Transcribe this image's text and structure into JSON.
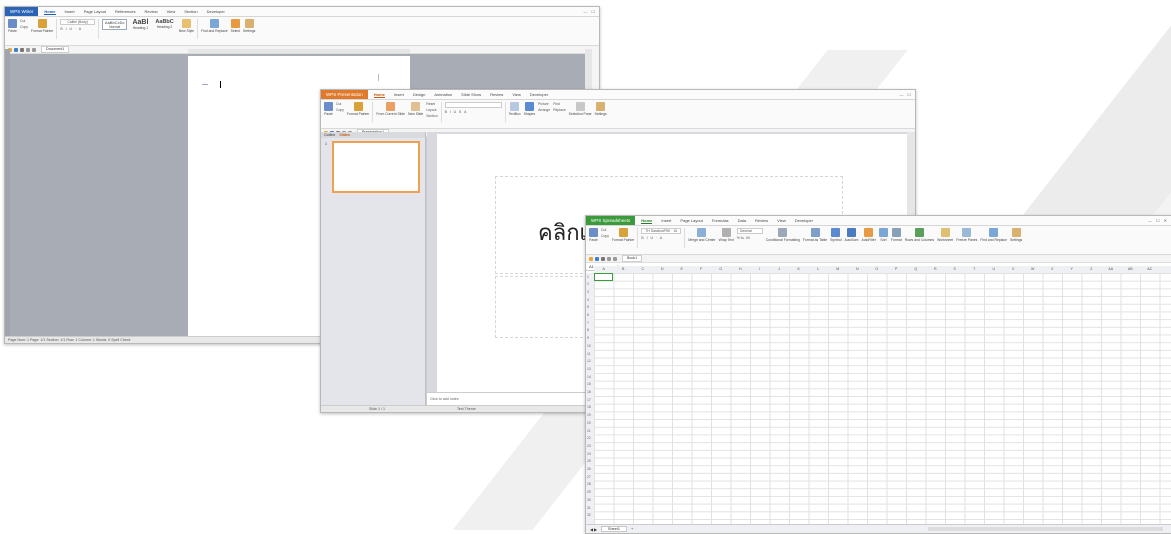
{
  "writer": {
    "app_button": "WPS Writer",
    "menu": [
      "Home",
      "Insert",
      "Page Layout",
      "References",
      "Review",
      "View",
      "Section",
      "Developer"
    ],
    "paste": "Paste",
    "cut": "Cut",
    "copy": "Copy",
    "format_painter": "Format Painter",
    "font": "Calibri (Body)",
    "styles": [
      {
        "preview": "AaBbCcDc",
        "name": "Normal"
      },
      {
        "preview": "AaBl",
        "name": "Heading 1"
      },
      {
        "preview": "AaBbC",
        "name": "Heading 2"
      }
    ],
    "new_style": "New Style",
    "find_replace": "Find and Replace",
    "select": "Select",
    "settings": "Settings",
    "doc_tab": "Document1",
    "status": "Page Num: 1   Page: 1/1   Section: 1/1   Row: 1   Column: 1   Words: 0   Spell Check"
  },
  "presentation": {
    "app_button": "WPS Presentation",
    "menu": [
      "Home",
      "Insert",
      "Design",
      "Animation",
      "Slide Show",
      "Review",
      "View",
      "Developer"
    ],
    "paste": "Paste",
    "cut": "Cut",
    "copy": "Copy",
    "format_painter": "Format Painter",
    "from_current_slide": "From Current Slide",
    "new_slide": "New Slide",
    "layout": "Layout",
    "reset": "Reset",
    "section": "Section",
    "textbox": "TextBox",
    "shapes": "Shapes",
    "arrange": "Arrange",
    "picture": "Picture",
    "find": "Find",
    "replace": "Replace",
    "selection_pane": "Selection Pane",
    "settings": "Settings",
    "doc_tab": "Presentation1",
    "panel_tabs": [
      "Outline",
      "Slides"
    ],
    "slide_number": "1",
    "title_placeholder": "คลิกเพิ่ม",
    "notes_placeholder": "Click to add notes",
    "status_left": "Slide 1 / 1",
    "status_right": "Text Theme"
  },
  "spreadsheet": {
    "app_button": "WPS Spreadsheets",
    "menu": [
      "Home",
      "Insert",
      "Page Layout",
      "Formulas",
      "Data",
      "Review",
      "View",
      "Developer"
    ],
    "paste": "Paste",
    "cut": "Cut",
    "copy": "Copy",
    "format_painter": "Format Painter",
    "font": "TH SarabunPSK",
    "font_size": "16",
    "number_format": "General",
    "merge_center": "Merge and Center",
    "wrap_text": "Wrap Text",
    "conditional_formatting": "Conditional Formatting",
    "format_as_table": "Format as Table",
    "symbol": "Symbol",
    "autosum": "AutoSum",
    "autofilter": "AutoFilter",
    "sort": "Sort",
    "format": "Format",
    "rows_columns": "Rows and Columns",
    "worksheet": "Worksheet",
    "freeze_panes": "Freeze Panes",
    "find_replace": "Find and Replace",
    "settings": "Settings",
    "doc_tab": "Book1",
    "name_box": "A1",
    "fx": "fx",
    "columns": [
      "A",
      "B",
      "C",
      "D",
      "E",
      "F",
      "G",
      "H",
      "I",
      "J",
      "K",
      "L",
      "M",
      "N",
      "O",
      "P",
      "Q",
      "R",
      "S",
      "T",
      "U",
      "V",
      "W",
      "X",
      "Y",
      "Z",
      "AA",
      "AB",
      "AC"
    ],
    "rows": [
      "1",
      "2",
      "3",
      "4",
      "5",
      "6",
      "7",
      "8",
      "9",
      "10",
      "11",
      "12",
      "13",
      "14",
      "15",
      "16",
      "17",
      "18",
      "19",
      "20",
      "21",
      "22",
      "23",
      "24",
      "25",
      "26",
      "27",
      "28",
      "29",
      "30",
      "31",
      "32"
    ],
    "sheet_tab": "Sheet1"
  },
  "colors": {
    "writer_accent": "#2b64b4",
    "presentation_accent": "#e07a2a",
    "spreadsheet_accent": "#3b9a3b",
    "selection_orange": "#f0a050"
  }
}
